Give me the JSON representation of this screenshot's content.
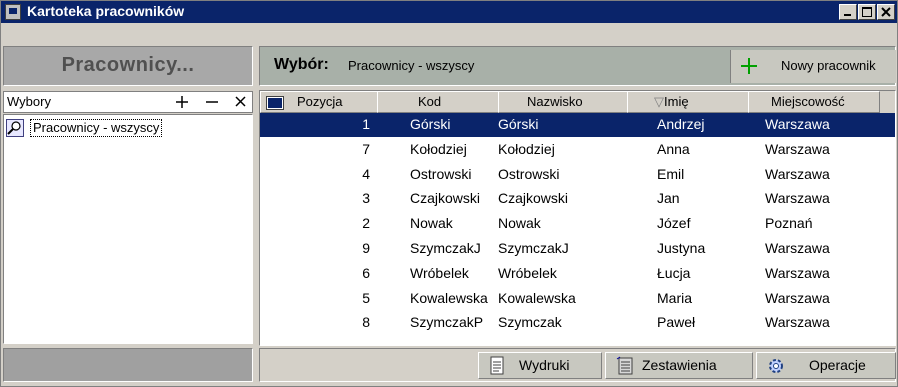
{
  "window": {
    "title": "Kartoteka pracowników"
  },
  "left": {
    "header": "Pracownicy...",
    "wybory_label": "Wybory",
    "tree_items": [
      "Pracownicy - wszyscy"
    ]
  },
  "right": {
    "wybor_label": "Wybór:",
    "wybor_value": "Pracownicy - wszyscy",
    "new_button": "Nowy pracownik"
  },
  "grid": {
    "columns": [
      "Pozycja",
      "Kod",
      "Nazwisko",
      "Imię",
      "Miejscowość"
    ],
    "sort_indicator": "▽",
    "rows": [
      [
        "1",
        "Górski",
        "Górski",
        "Andrzej",
        "Warszawa"
      ],
      [
        "7",
        "Kołodziej",
        "Kołodziej",
        "Anna",
        "Warszawa"
      ],
      [
        "4",
        "Ostrowski",
        "Ostrowski",
        "Emil",
        "Warszawa"
      ],
      [
        "3",
        "Czajkowski",
        "Czajkowski",
        "Jan",
        "Warszawa"
      ],
      [
        "2",
        "Nowak",
        "Nowak",
        "Józef",
        "Poznań"
      ],
      [
        "9",
        "SzymczakJ",
        "SzymczakJ",
        "Justyna",
        "Warszawa"
      ],
      [
        "6",
        "Wróbelek",
        "Wróbelek",
        "Łucja",
        "Warszawa"
      ],
      [
        "5",
        "Kowalewska",
        "Kowalewska",
        "Maria",
        "Warszawa"
      ],
      [
        "8",
        "SzymczakP",
        "Szymczak",
        "Paweł",
        "Warszawa"
      ]
    ]
  },
  "toolbar": {
    "wydruki": "Wydruki",
    "zestawienia": "Zestawienia",
    "operacje": "Operacje"
  },
  "colors": {
    "titlebar": "#0a246a",
    "selection": "#0a246a",
    "plus_green": "#00a000"
  }
}
